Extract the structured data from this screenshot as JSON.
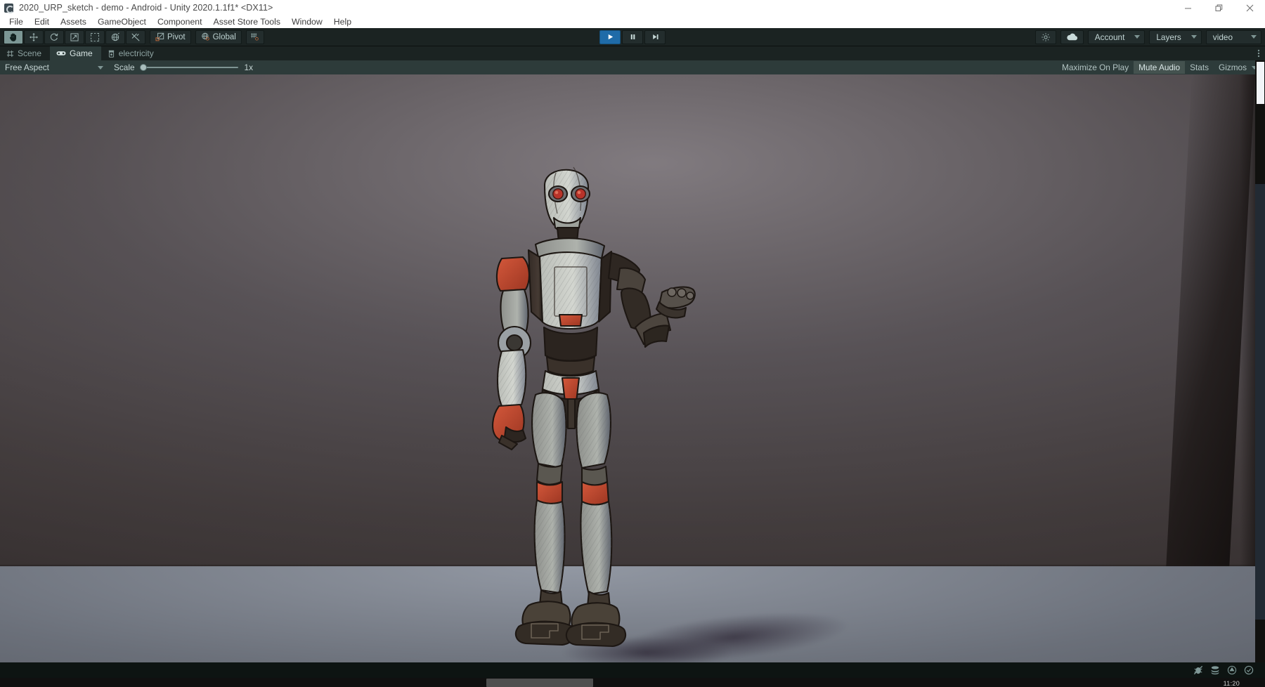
{
  "window": {
    "title": "2020_URP_sketch - demo - Android - Unity 2020.1.1f1* <DX11>",
    "app_icon": "unity-icon",
    "controls": {
      "minimize": "minimize-icon",
      "maximize": "restore-icon",
      "close": "close-icon"
    }
  },
  "menubar": {
    "items": [
      {
        "label": "File"
      },
      {
        "label": "Edit"
      },
      {
        "label": "Assets"
      },
      {
        "label": "GameObject"
      },
      {
        "label": "Component"
      },
      {
        "label": "Asset Store Tools"
      },
      {
        "label": "Window"
      },
      {
        "label": "Help"
      }
    ]
  },
  "toolbar": {
    "tools": [
      {
        "name": "hand-tool",
        "icon": "hand-icon",
        "active": true
      },
      {
        "name": "move-tool",
        "icon": "move-icon",
        "active": false
      },
      {
        "name": "rotate-tool",
        "icon": "rotate-icon",
        "active": false
      },
      {
        "name": "scale-tool",
        "icon": "scale-icon",
        "active": false
      },
      {
        "name": "rect-tool",
        "icon": "rect-transform-icon",
        "active": false
      },
      {
        "name": "transform-tool",
        "icon": "transform-icon",
        "active": false
      },
      {
        "name": "custom-editor-tool",
        "icon": "wrench-icon",
        "active": false
      }
    ],
    "pivot_label": "Pivot",
    "pivot_icon": "pivot-icon",
    "global_label": "Global",
    "global_icon": "globe-icon",
    "snap_icon": "grid-snap-icon",
    "play_label": "play-icon",
    "pause_label": "pause-icon",
    "step_label": "step-icon",
    "is_playing": true,
    "collab_icon": "collab-brightness-icon",
    "cloud_icon": "cloud-icon",
    "account_label": "Account",
    "layers_label": "Layers",
    "layout_label": "video"
  },
  "tabs": [
    {
      "label": "Scene",
      "icon": "scene-grid-icon",
      "active": false
    },
    {
      "label": "Game",
      "icon": "gamepad-icon",
      "active": true
    },
    {
      "label": "electricity",
      "icon": "animation-clip-icon",
      "active": false
    }
  ],
  "tabrow_kebab": "kebab-menu-icon",
  "game_toolbar": {
    "aspect_label": "Free Aspect",
    "scale_label": "Scale",
    "scale_value": "1x",
    "scale_percent": 0,
    "maximize_on_play": "Maximize On Play",
    "mute_audio": "Mute Audio",
    "mute_audio_toggled": true,
    "stats": "Stats",
    "gizmos": "Gizmos"
  },
  "game_view": {
    "scene_description": "sketch-shaded humanoid robot standing on a gray floor against a dark wall",
    "character_name": "robot-character",
    "colors": {
      "wall": "#4c4547",
      "floor": "#6e737d",
      "accent_red": "#c0432c",
      "body_light": "#c8cbc6",
      "body_dark": "#2e2723"
    }
  },
  "status_bar": {
    "icons": [
      {
        "name": "muted-bug-icon"
      },
      {
        "name": "stacked-layers-icon"
      },
      {
        "name": "unity-cloud-status-icon"
      },
      {
        "name": "ready-check-icon"
      }
    ]
  },
  "taskbar": {
    "tile": "active-window-tile",
    "clock": "11:20"
  }
}
